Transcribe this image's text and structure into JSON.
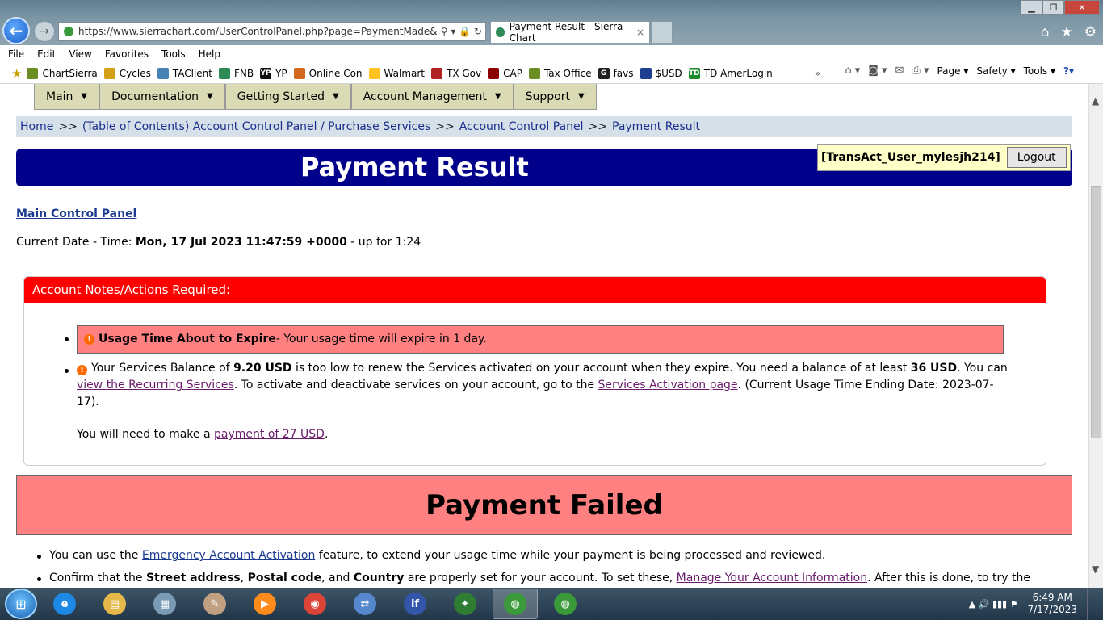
{
  "browser": {
    "url": "https://www.sierrachart.com/UserControlPanel.php?page=PaymentMade&UserID:",
    "tab_active": "Payment Result - Sierra Chart",
    "tab_close": "×",
    "addr_icons": "⚲ ▾ 🔒 ↻",
    "win_min": "▁",
    "win_max": "❐",
    "win_close": "✕",
    "home_icon": "⌂",
    "star_icon": "★",
    "gear_icon": "⚙"
  },
  "menubar": [
    "File",
    "Edit",
    "View",
    "Favorites",
    "Tools",
    "Help"
  ],
  "favorites": [
    {
      "label": "ChartSierra",
      "icon": "page-icon",
      "color": "#6b8e23"
    },
    {
      "label": "Cycles",
      "icon": "globe-icon",
      "color": "#d4a017"
    },
    {
      "label": "TAClient",
      "icon": "wave-icon",
      "color": "#4682b4"
    },
    {
      "label": "FNB",
      "icon": "tree-icon",
      "color": "#2e8b57"
    },
    {
      "label": "YP",
      "icon": "yp-icon",
      "color": "#111111",
      "glyph": "YP"
    },
    {
      "label": "Online Con",
      "icon": "flame-icon",
      "color": "#d2691e"
    },
    {
      "label": "Walmart",
      "icon": "spark-icon",
      "color": "#ffc220"
    },
    {
      "label": "TX Gov",
      "icon": "tx-icon",
      "color": "#b22222"
    },
    {
      "label": "CAP",
      "icon": "cap-icon",
      "color": "#8b0000"
    },
    {
      "label": "Tax Office",
      "icon": "page-icon",
      "color": "#6b8e23"
    },
    {
      "label": "favs",
      "icon": "g-icon",
      "color": "#222222",
      "glyph": "G"
    },
    {
      "label": "$USD",
      "icon": "chart-icon",
      "color": "#1e3f8f"
    },
    {
      "label": "TD AmerLogin",
      "icon": "td-icon",
      "color": "#1a8a2a",
      "glyph": "TD"
    }
  ],
  "favbar_more": "»",
  "commandbar": {
    "page": "Page ▾",
    "safety": "Safety ▾",
    "tools": "Tools ▾",
    "help": "?▾"
  },
  "site_nav": [
    "Main",
    "Documentation",
    "Getting Started",
    "Account Management",
    "Support"
  ],
  "nav_caret": "▼",
  "breadcrumb": {
    "home": "Home",
    "toc": "(Table of Contents) Account Control Panel / Purchase Services",
    "acp": "Account Control Panel",
    "current": "Payment Result",
    "sep": ">>"
  },
  "page_title": "Payment Result",
  "user": {
    "name": "[TransAct_User_mylesjh214]",
    "logout": "Logout"
  },
  "main_control_panel": "Main Control Panel",
  "datetime": {
    "prefix": "Current Date - Time: ",
    "value": "Mon, 17 Jul 2023 11:47:59 +0000",
    "suffix": " - up for 1:24"
  },
  "notes": {
    "header": "Account Notes/Actions Required:",
    "warn_glyph": "!",
    "n1_bold": "Usage Time About to Expire",
    "n1_rest": " - Your usage time will expire in 1 day.",
    "n2_a": "Your Services Balance of ",
    "n2_bal": "9.20 USD",
    "n2_b": " is too low to renew the Services activated on your account when they expire. You need a balance of at least ",
    "n2_req": "36 USD",
    "n2_c": ". You can ",
    "n2_link1": "view the Recurring Services",
    "n2_d": ". To activate and deactivate services on your account, go to the ",
    "n2_link2": "Services Activation page",
    "n2_e": ". (Current Usage Time Ending Date: 2023-07-17).",
    "n3_a": "You will need to make a ",
    "n3_link": "payment of 27 USD",
    "n3_b": "."
  },
  "payment_failed": "Payment Failed",
  "bullets": {
    "b1_a": "You can use the ",
    "b1_link": "Emergency Account Activation",
    "b1_b": " feature, to extend your usage time while your payment is being processed and reviewed.",
    "b2_a": "Confirm that the ",
    "b2_s": "Street address",
    "b2_c1": ", ",
    "b2_p": "Postal code",
    "b2_c2": ", and ",
    "b2_co": "Country",
    "b2_b": " are properly set for your account. To set these, ",
    "b2_link": "Manage Your Account Information",
    "b2_c": ". After this is done, to try the"
  },
  "scroll": {
    "up": "▲",
    "down": "▼"
  },
  "taskbar": {
    "start_glyph": "⊞",
    "apps": [
      {
        "name": "ie-icon",
        "color": "#1e88e5",
        "glyph": "e"
      },
      {
        "name": "folder-icon",
        "color": "#e6b84a",
        "glyph": "▤"
      },
      {
        "name": "calculator-icon",
        "color": "#7b9bb5",
        "glyph": "▦"
      },
      {
        "name": "paint-icon",
        "color": "#c0a080",
        "glyph": "✎"
      },
      {
        "name": "media-icon",
        "color": "#ff8c1a",
        "glyph": "▶"
      },
      {
        "name": "chrome-icon",
        "color": "#db4437",
        "glyph": "◉"
      },
      {
        "name": "network-icon",
        "color": "#5588cc",
        "glyph": "⇄"
      },
      {
        "name": "if-icon",
        "color": "#3355aa",
        "glyph": "if"
      },
      {
        "name": "map-icon",
        "color": "#2e7d32",
        "glyph": "✦"
      },
      {
        "name": "globe-icon-1",
        "color": "#3a9a3a",
        "glyph": "◍"
      },
      {
        "name": "globe-icon-2",
        "color": "#3a9a3a",
        "glyph": "◍"
      }
    ],
    "tray_glyphs": "▲ 🔊 ▮▮▮ ⚑",
    "time": "6:49 AM",
    "date": "7/17/2023"
  }
}
